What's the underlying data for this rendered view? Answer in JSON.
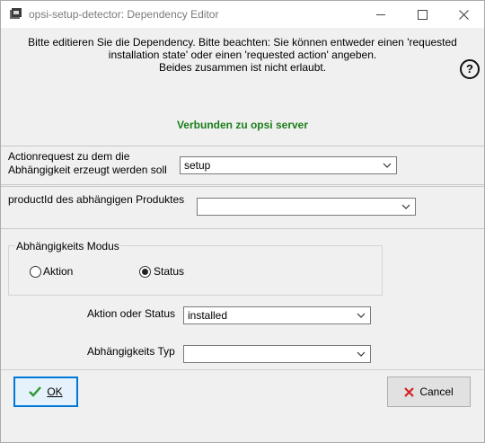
{
  "window": {
    "title": "opsi-setup-detector: Dependency Editor"
  },
  "info": {
    "message": "Bitte editieren Sie die Dependency. Bitte beachten: Sie können entweder einen 'requested\ninstallation state' oder einen 'requested action' angeben.\nBeides zusammen ist nicht erlaubt.",
    "connection_status": "Verbunden zu opsi server"
  },
  "form": {
    "action_request_label": "Actionrequest zu dem die\nAbhängigkeit erzeugt werden soll",
    "action_request_value": "setup",
    "product_id_label": "productId des abhängigen Produktes",
    "product_id_value": "",
    "mode_group_label": "Abhängigkeits Modus",
    "mode_options": [
      {
        "label": "Aktion",
        "selected": false
      },
      {
        "label": "Status",
        "selected": true
      }
    ],
    "action_or_status_label": "Aktion oder Status",
    "action_or_status_value": "installed",
    "dependency_type_label": "Abhängigkeits Typ",
    "dependency_type_value": ""
  },
  "buttons": {
    "ok_label": "OK",
    "cancel_label": "Cancel"
  },
  "colors": {
    "connected": "#1a7f1a",
    "ok_check": "#2e9a2e",
    "cancel_x": "#d42020",
    "focus_border": "#0078d7"
  },
  "icons": {
    "app": "app-icon",
    "help": "help-icon",
    "ok": "check-icon",
    "cancel": "x-icon"
  }
}
